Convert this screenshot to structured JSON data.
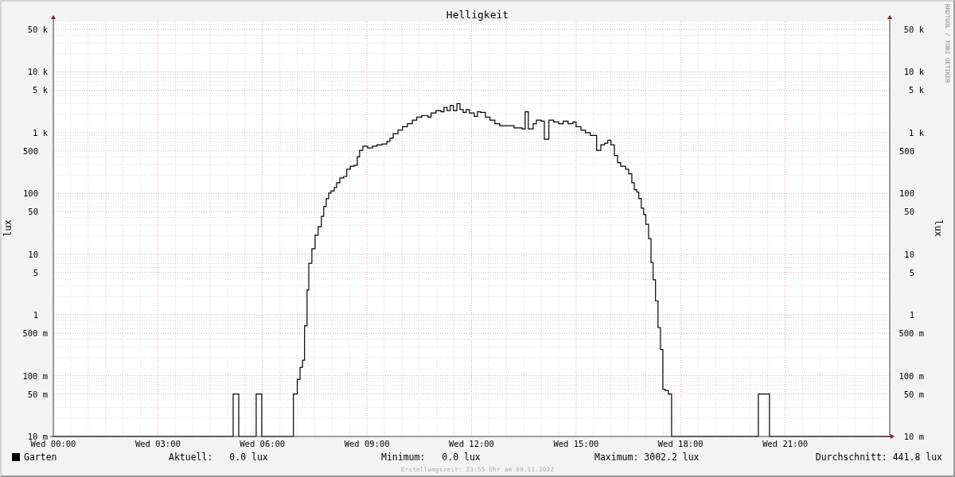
{
  "chart": {
    "title": "Helligkeit",
    "ylabel": "lux",
    "y2label": "lux",
    "xticks": [
      "Wed 00:00",
      "Wed 03:00",
      "Wed 06:00",
      "Wed 09:00",
      "Wed 12:00",
      "Wed 15:00",
      "Wed 18:00",
      "Wed 21:00"
    ],
    "yticks": [
      "50 k",
      "10 k",
      "5 k",
      "1 k",
      "500",
      "100",
      "50",
      "10",
      "5",
      "1",
      "500 m",
      "100 m",
      "50 m",
      "10 m"
    ],
    "y2ticks": [
      "50 k",
      "10 k",
      "5 k",
      "1 k",
      "500",
      "100",
      "50",
      "10",
      "5",
      "1",
      "500 m",
      "100 m",
      "50 m",
      "10 m"
    ]
  },
  "credit": "RRDTOOL / TOBI OETIKER",
  "legend": {
    "series_label": "Garten",
    "color": "#000000",
    "stats": [
      {
        "label": "Aktuell:",
        "value": "0.0 lux"
      },
      {
        "label": "Minimum:",
        "value": "0.0 lux"
      },
      {
        "label": "Maximum:",
        "value": "3002.2 lux"
      },
      {
        "label": "Durchschnitt:",
        "value": "441.8 lux"
      }
    ]
  },
  "footer": "Erstellungszeit: 23:55 Uhr am 09.11.2022"
}
